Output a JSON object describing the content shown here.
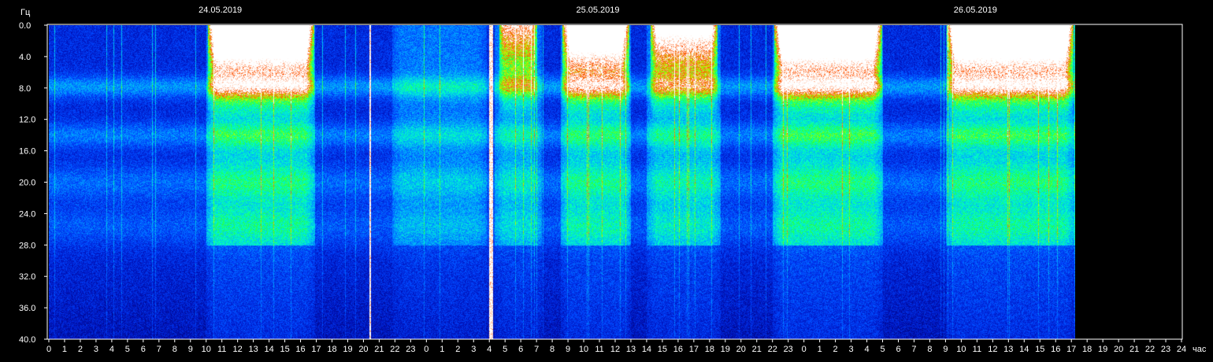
{
  "chart_data": {
    "type": "heatmap",
    "title": "",
    "ylabel": "Гц",
    "xlabel": "час",
    "ylim": [
      0,
      40
    ],
    "y_ticks": [
      "0.0",
      "4.0",
      "8.0",
      "12.0",
      "16.0",
      "20.0",
      "24.0",
      "28.0",
      "32.0",
      "36.0",
      "40.0"
    ],
    "x_ticks": [
      "0",
      "1",
      "2",
      "3",
      "4",
      "5",
      "6",
      "7",
      "8",
      "9",
      "10",
      "11",
      "12",
      "13",
      "14",
      "15",
      "16",
      "17",
      "18",
      "19",
      "20",
      "21",
      "22",
      "23",
      "0",
      "1",
      "2",
      "3",
      "4",
      "5",
      "6",
      "7",
      "8",
      "9",
      "10",
      "11",
      "12",
      "13",
      "14",
      "15",
      "16",
      "17",
      "18",
      "19",
      "20",
      "21",
      "22",
      "23",
      "0",
      "1",
      "2",
      "3",
      "4",
      "5",
      "6",
      "7",
      "8",
      "9",
      "10",
      "11",
      "12",
      "13",
      "14",
      "15",
      "16",
      "17",
      "18",
      "19",
      "20",
      "21",
      "22",
      "23",
      "24"
    ],
    "dates": [
      {
        "label": "24.05.2019",
        "hour": 12
      },
      {
        "label": "25.05.2019",
        "hour": 36
      },
      {
        "label": "26.05.2019",
        "hour": 60
      }
    ],
    "data_end_hour": 65.2,
    "total_hours": 72,
    "colorscale": [
      "#000060",
      "#0018c8",
      "#0050ff",
      "#00b4ff",
      "#00ffb0",
      "#40ff30",
      "#c0ff00",
      "#ff4000",
      "#ffffff"
    ],
    "intensity_episodes": [
      {
        "start": 10.0,
        "end": 16.9,
        "strength": 1.0
      },
      {
        "start": 21.8,
        "end": 27.8,
        "strength": 0.55
      },
      {
        "start": 28.3,
        "end": 31.3,
        "strength": 0.75
      },
      {
        "start": 32.5,
        "end": 37.0,
        "strength": 0.95
      },
      {
        "start": 38.0,
        "end": 42.7,
        "strength": 0.85
      },
      {
        "start": 46.0,
        "end": 53.0,
        "strength": 1.0
      },
      {
        "start": 57.0,
        "end": 65.2,
        "strength": 1.0
      }
    ]
  }
}
